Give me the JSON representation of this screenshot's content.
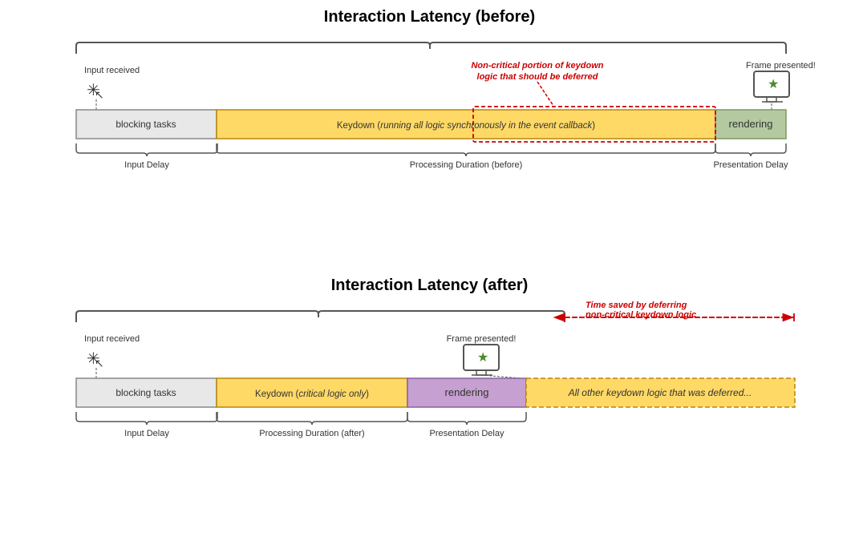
{
  "top": {
    "title": "Interaction Latency (before)",
    "input_received": "Input received",
    "frame_presented": "Frame presented!",
    "bar_blocking": "blocking tasks",
    "bar_keydown": "Keydown (running all logic synchronously in the event callback)",
    "bar_rendering": "rendering",
    "red_annotation_line1": "Non-critical portion of keydown",
    "red_annotation_line2": "logic that should be deferred",
    "label_input_delay": "Input Delay",
    "label_processing": "Processing Duration (before)",
    "label_presentation": "Presentation Delay"
  },
  "bottom": {
    "title": "Interaction Latency (after)",
    "input_received": "Input received",
    "frame_presented": "Frame presented!",
    "bar_blocking": "blocking tasks",
    "bar_keydown": "Keydown (critical logic only)",
    "bar_rendering": "rendering",
    "bar_deferred": "All other keydown logic that was deferred...",
    "time_saved_line1": "Time saved by deferring",
    "time_saved_line2": "non-critical keydown logic",
    "label_input_delay": "Input Delay",
    "label_processing": "Processing Duration (after)",
    "label_presentation": "Presentation Delay"
  }
}
